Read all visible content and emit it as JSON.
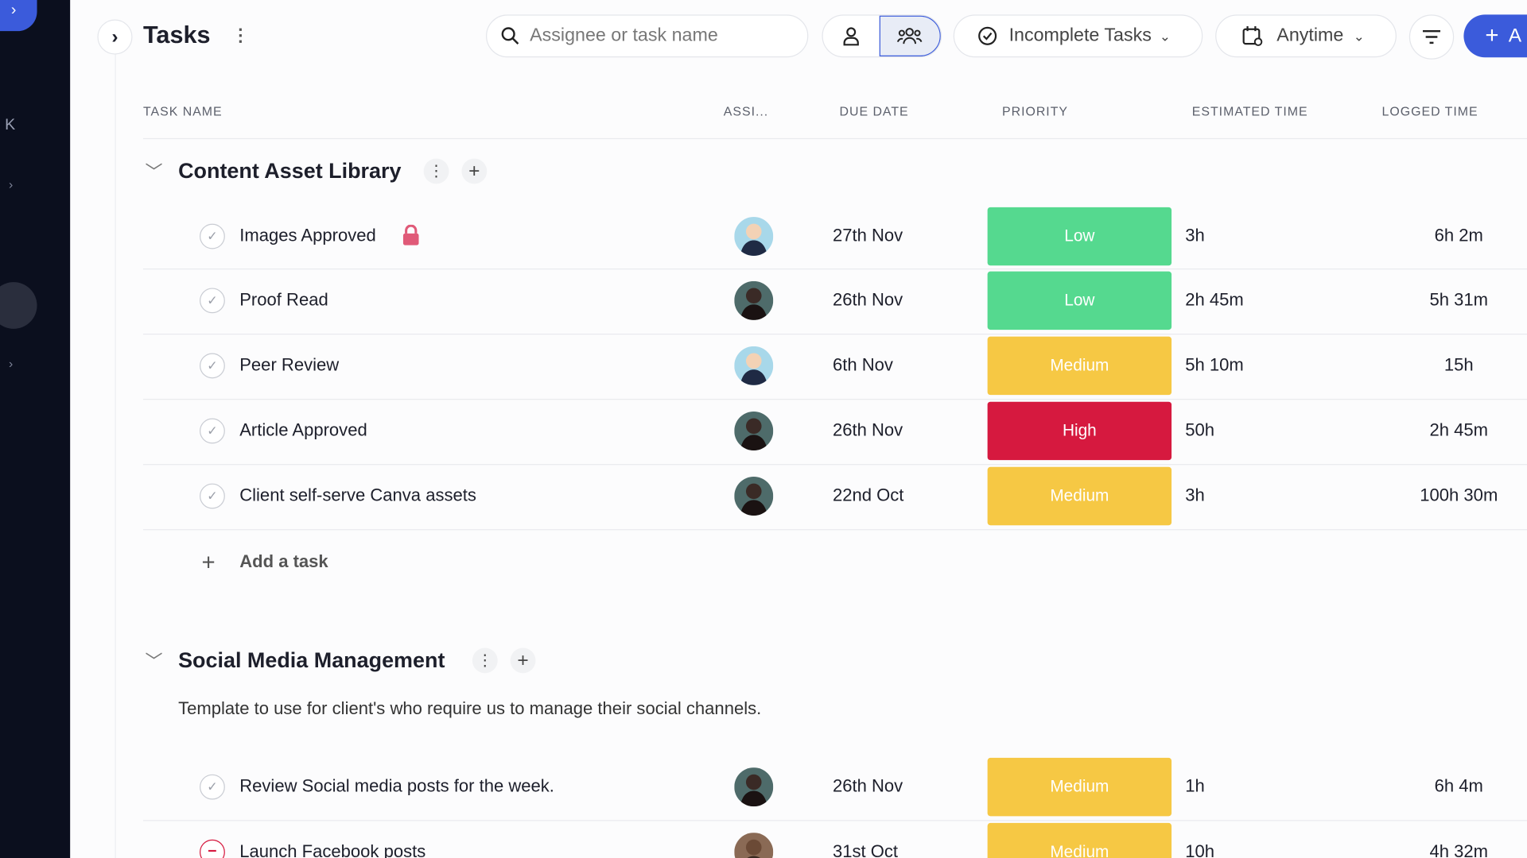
{
  "sidebar": {
    "letter": "K"
  },
  "header": {
    "title": "Tasks",
    "search_placeholder": "Assignee or task name",
    "status_filter": "Incomplete Tasks",
    "date_filter": "Anytime",
    "add_button": "A"
  },
  "columns": [
    "TASK NAME",
    "ASSI...",
    "DUE DATE",
    "PRIORITY",
    "ESTIMATED TIME",
    "LOGGED TIME"
  ],
  "colors": {
    "low": "#55d98f",
    "medium": "#f6c844",
    "high": "#d6193f",
    "accent": "#3b5bdb",
    "sidebar": "#0b0f1e"
  },
  "groups": [
    {
      "title": "Content Asset Library",
      "add_task": "Add a task",
      "tasks": [
        {
          "name": "Images Approved",
          "locked": true,
          "avatar": "light",
          "due": "27th Nov",
          "priority": "Low",
          "estimated": "3h",
          "logged": "6h 2m",
          "status": "check"
        },
        {
          "name": "Proof Read",
          "avatar": "dark",
          "due": "26th Nov",
          "priority": "Low",
          "estimated": "2h 45m",
          "logged": "5h 31m",
          "status": "check"
        },
        {
          "name": "Peer Review",
          "avatar": "light",
          "due": "6th Nov",
          "priority": "Medium",
          "estimated": "5h 10m",
          "logged": "15h",
          "status": "check"
        },
        {
          "name": "Article Approved",
          "avatar": "dark",
          "due": "26th Nov",
          "priority": "High",
          "estimated": "50h",
          "logged": "2h 45m",
          "status": "check"
        },
        {
          "name": "Client self-serve Canva assets",
          "avatar": "dark",
          "due": "22nd Oct",
          "priority": "Medium",
          "estimated": "3h",
          "logged": "100h 30m",
          "status": "check"
        }
      ]
    },
    {
      "title": "Social Media Management",
      "description": "Template to use for client's who require us to manage their social channels.",
      "tasks": [
        {
          "name": "Review Social media posts for the week.",
          "avatar": "dark",
          "due": "26th Nov",
          "priority": "Medium",
          "estimated": "1h",
          "logged": "6h 4m",
          "status": "check"
        },
        {
          "name": "Launch Facebook posts",
          "avatar": "brown",
          "due": "31st Oct",
          "priority": "Medium",
          "estimated": "10h",
          "logged": "4h 32m",
          "status": "blocked"
        }
      ]
    }
  ]
}
